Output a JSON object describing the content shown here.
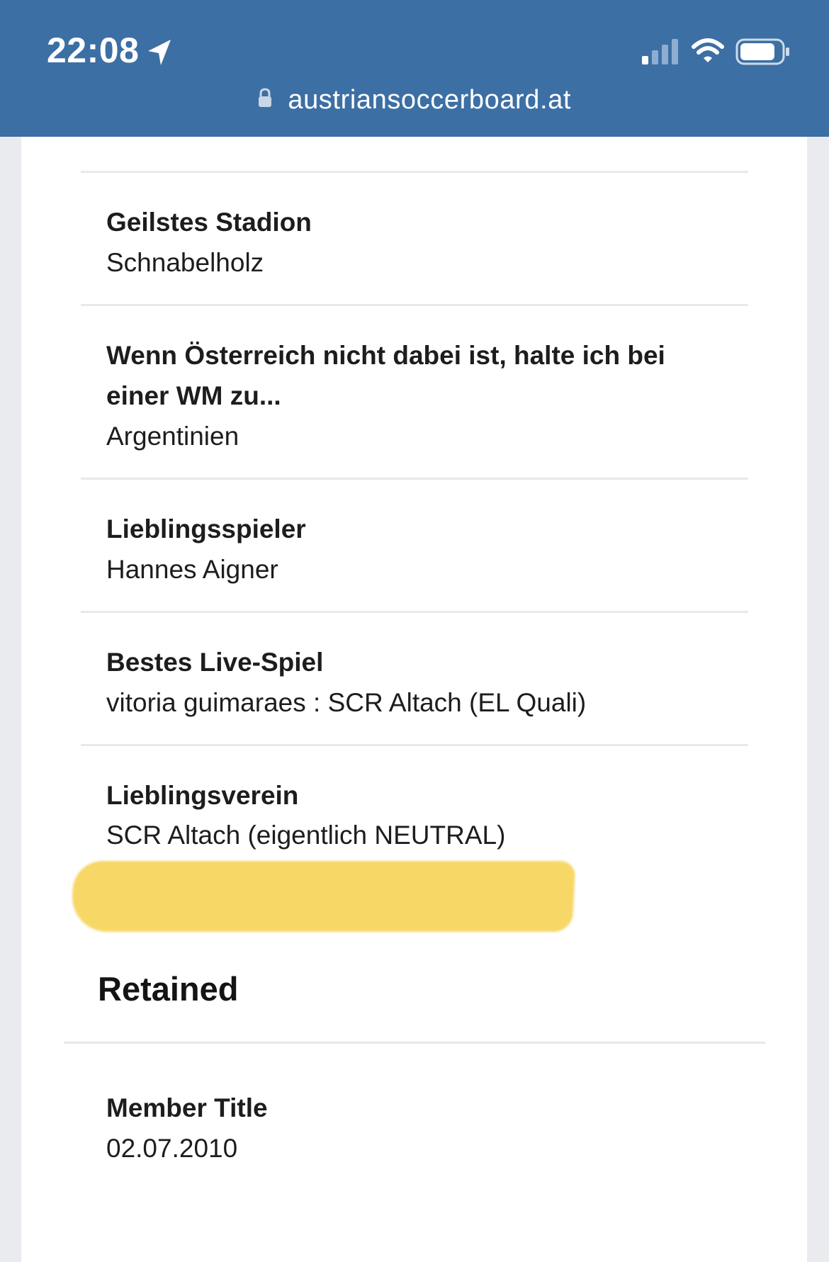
{
  "status_bar": {
    "time": "22:08",
    "url": "austriansoccerboard.at",
    "background": "#3c6fa4"
  },
  "profile": {
    "fields": [
      {
        "label": "Geilstes Stadion",
        "value": "Schnabelholz"
      },
      {
        "label": "Wenn Österreich nicht dabei ist, halte ich bei einer WM zu...",
        "value": "Argentinien"
      },
      {
        "label": "Lieblingsspieler",
        "value": "Hannes Aigner"
      },
      {
        "label": "Bestes Live-Spiel",
        "value": "vitoria guimaraes : SCR Altach (EL Quali)"
      },
      {
        "label": "Lieblingsverein",
        "value": "SCR Altach (eigentlich NEUTRAL)"
      }
    ],
    "highlight_color": "#f7d766"
  },
  "retained": {
    "title": "Retained",
    "fields": [
      {
        "label": "Member Title",
        "value": "02.07.2010"
      }
    ]
  }
}
